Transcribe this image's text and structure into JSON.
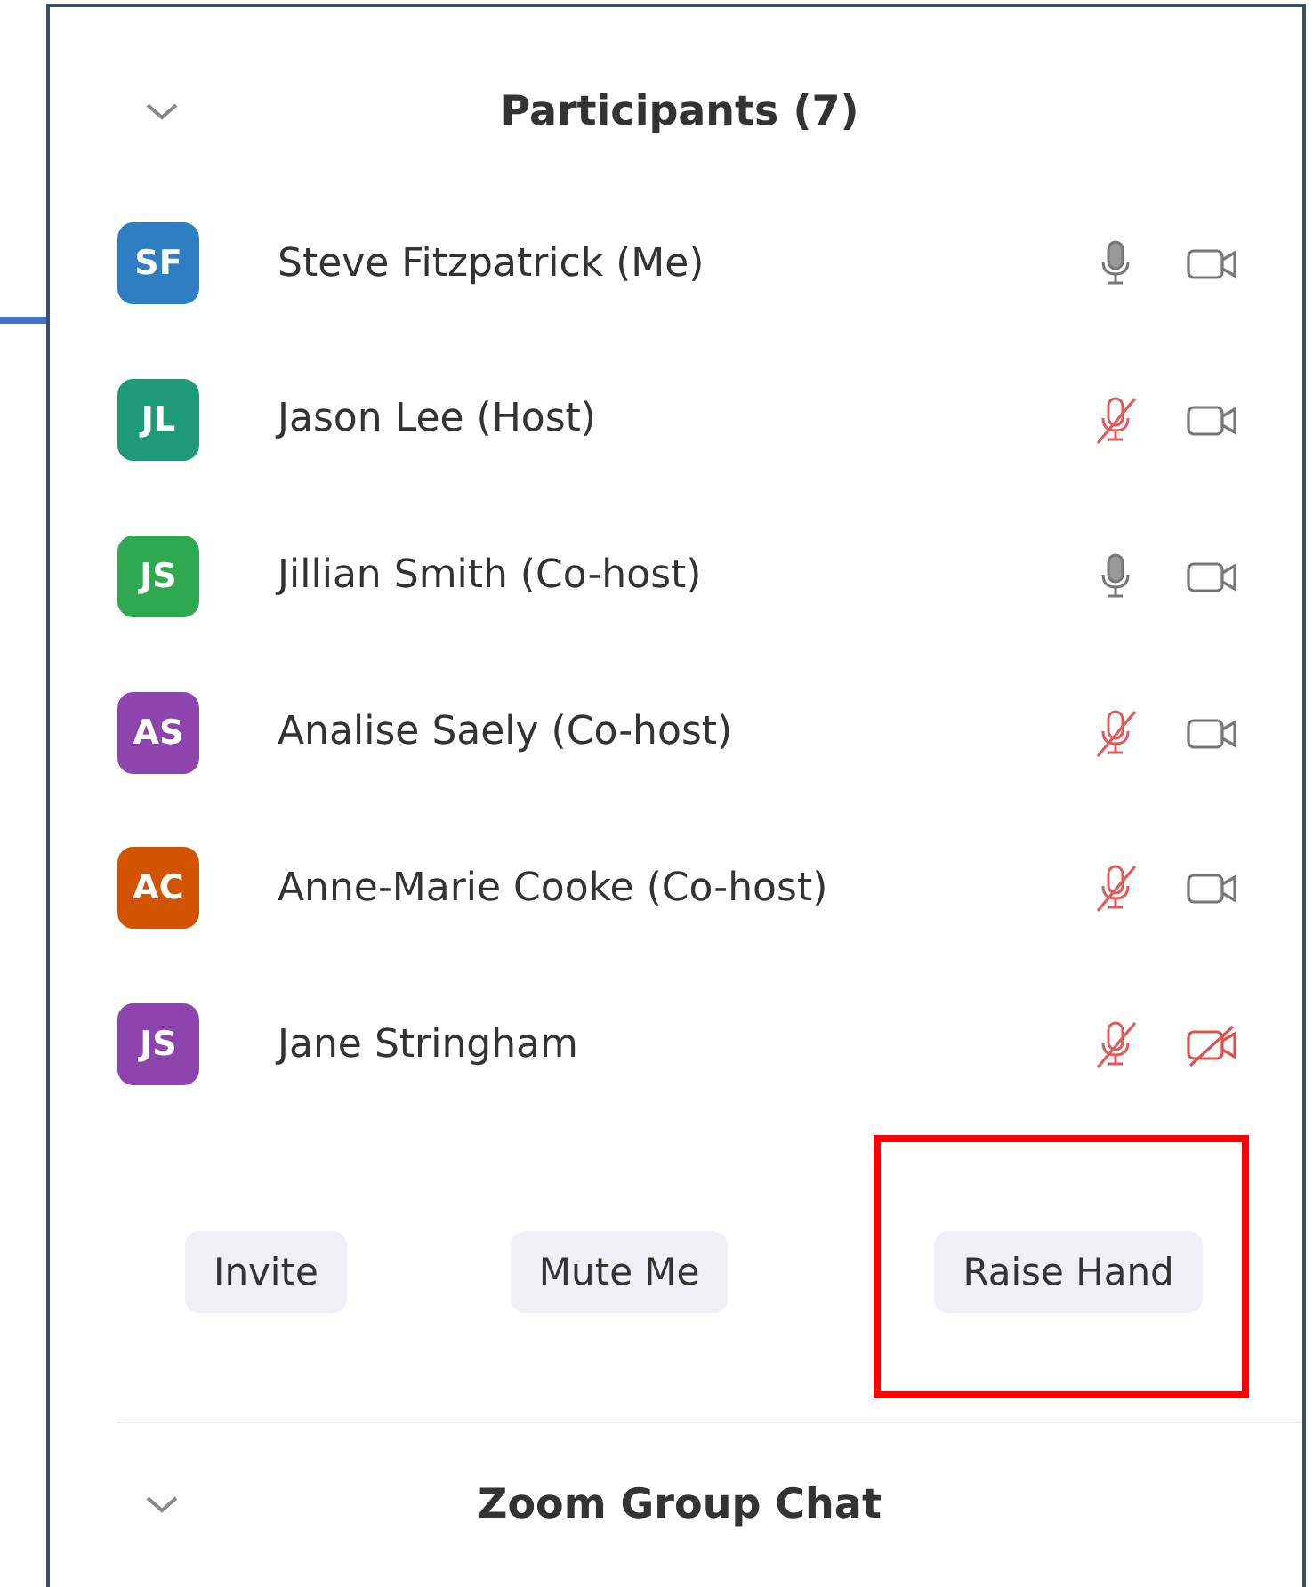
{
  "participants_section": {
    "title": "Participants (7)",
    "expanded": true
  },
  "participants": [
    {
      "initials": "SF",
      "name": "Steve Fitzpatrick (Me)",
      "color": "#2d7fc1",
      "mic_muted": false,
      "video_off": false
    },
    {
      "initials": "JL",
      "name": "Jason Lee (Host)",
      "color": "#1e9a78",
      "mic_muted": true,
      "video_off": false
    },
    {
      "initials": "JS",
      "name": "Jillian Smith (Co-host)",
      "color": "#2fa84f",
      "mic_muted": false,
      "video_off": false
    },
    {
      "initials": "AS",
      "name": "Analise Saely (Co-host)",
      "color": "#8e44ad",
      "mic_muted": true,
      "video_off": false
    },
    {
      "initials": "AC",
      "name": "Anne-Marie Cooke (Co-host)",
      "color": "#d35400",
      "mic_muted": true,
      "video_off": false
    },
    {
      "initials": "JS",
      "name": "Jane Stringham",
      "color": "#8e44ad",
      "mic_muted": true,
      "video_off": true
    }
  ],
  "buttons": [
    {
      "label": "Invite",
      "highlighted": false
    },
    {
      "label": "Mute Me",
      "highlighted": false
    },
    {
      "label": "Raise Hand",
      "highlighted": true
    }
  ],
  "chat_section": {
    "title": "Zoom Group Chat",
    "expanded": false
  }
}
